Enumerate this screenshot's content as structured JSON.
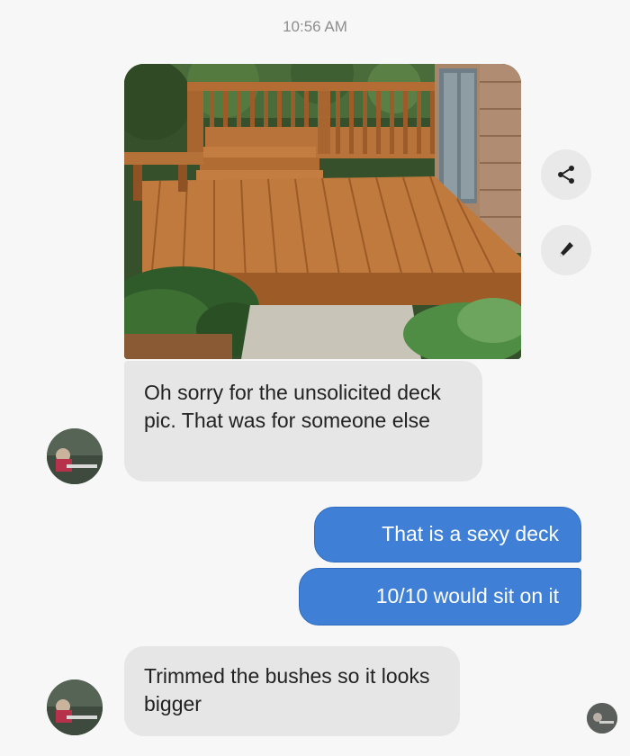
{
  "conversation": {
    "timestamp": "10:56 AM",
    "photo": {
      "subject": "wooden-deck-photo"
    },
    "actions": {
      "share_icon": "share-icon",
      "edit_icon": "pencil-icon"
    },
    "messages": [
      {
        "direction": "incoming",
        "text": "Oh sorry for the unsolicited deck pic. That was for someone else"
      },
      {
        "direction": "outgoing",
        "text": "That is a sexy deck"
      },
      {
        "direction": "outgoing",
        "text": "10/10 would sit on it"
      },
      {
        "direction": "incoming",
        "text": "Trimmed the bushes so it looks bigger"
      }
    ]
  },
  "colors": {
    "background": "#f7f7f7",
    "incoming_bubble": "#e6e6e6",
    "outgoing_bubble": "#3f80d6",
    "timestamp_text": "#8e8e8e"
  }
}
